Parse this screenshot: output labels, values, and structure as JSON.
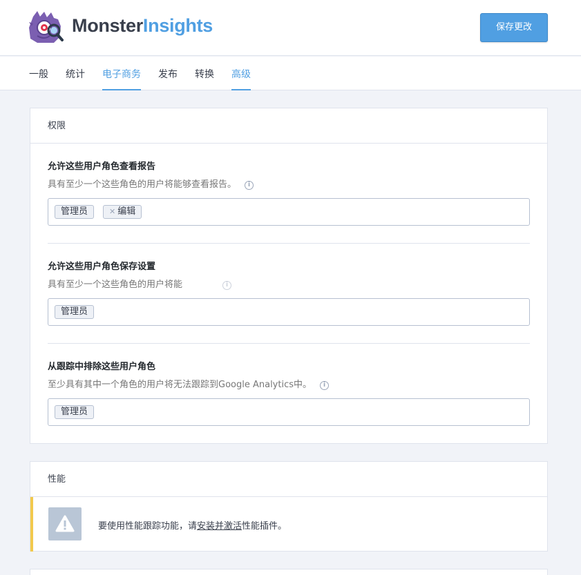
{
  "header": {
    "brand_part1": "Monster",
    "brand_part2": "Insights",
    "save_label": "保存更改"
  },
  "tabs": [
    {
      "label": "一般"
    },
    {
      "label": "统计"
    },
    {
      "label": "电子商务"
    },
    {
      "label": "发布"
    },
    {
      "label": "转换"
    },
    {
      "label": "高级"
    }
  ],
  "permissions": {
    "title": "权限",
    "sections": [
      {
        "title": "允许这些用户角色查看报告",
        "desc": "具有至少一个这些角色的用户将能够查看报告。",
        "chips": [
          "管理员",
          "编辑"
        ]
      },
      {
        "title": "允许这些用户角色保存设置",
        "desc": "具有至少一个这些角色的用户将能",
        "chips": [
          "管理员"
        ]
      },
      {
        "title": "从跟踪中排除这些用户角色",
        "desc": "至少具有其中一个角色的用户将无法跟踪到Google Analytics中。",
        "chips": [
          "管理员"
        ]
      }
    ]
  },
  "performance": {
    "title": "性能",
    "notice_prefix": "要使用性能跟踪功能，请",
    "notice_link": "安装并激活",
    "notice_suffix": "性能插件。"
  },
  "colors": {
    "accent": "#509fe2",
    "warning_border": "#f2c94c",
    "logo_purple": "#7b5fb1"
  }
}
